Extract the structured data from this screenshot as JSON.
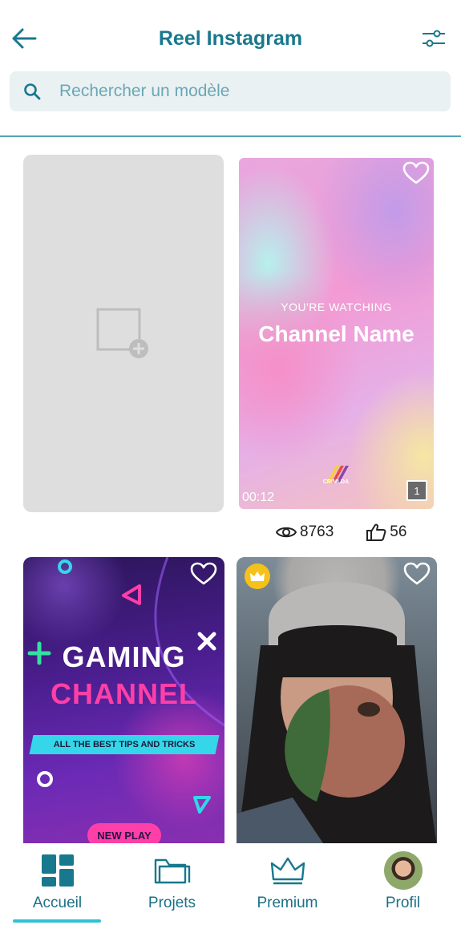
{
  "header": {
    "title": "Reel Instagram",
    "back_icon": "arrow-left-icon",
    "filter_icon": "sliders-icon"
  },
  "search": {
    "placeholder": "Rechercher un modèle",
    "icon": "search-icon"
  },
  "templates": [
    {
      "kind": "new",
      "icon": "add-image-icon"
    },
    {
      "kind": "reel",
      "subtitle": "YOU'RE WATCHING",
      "headline": "Channel Name",
      "brand": "CRIMLDA",
      "duration": "00:12",
      "pages": "1",
      "views": "8763",
      "likes": "56"
    },
    {
      "kind": "gaming",
      "title": "GAMING",
      "subtitle": "CHANNEL",
      "band": "ALL THE BEST TIPS AND TRICKS",
      "button": "NEW PLAY"
    },
    {
      "kind": "photo",
      "premium_icon": "crown-icon"
    }
  ],
  "nav": {
    "items": [
      {
        "label": "Accueil",
        "icon": "dashboard-icon",
        "active": true
      },
      {
        "label": "Projets",
        "icon": "folder-icon",
        "active": false
      },
      {
        "label": "Premium",
        "icon": "crown-icon",
        "active": false
      },
      {
        "label": "Profil",
        "icon": "avatar",
        "active": false
      }
    ]
  },
  "colors": {
    "primary": "#18788d",
    "accent": "#2dc2d8",
    "search_bg": "#eaf1f3",
    "premium": "#f5c21b"
  }
}
